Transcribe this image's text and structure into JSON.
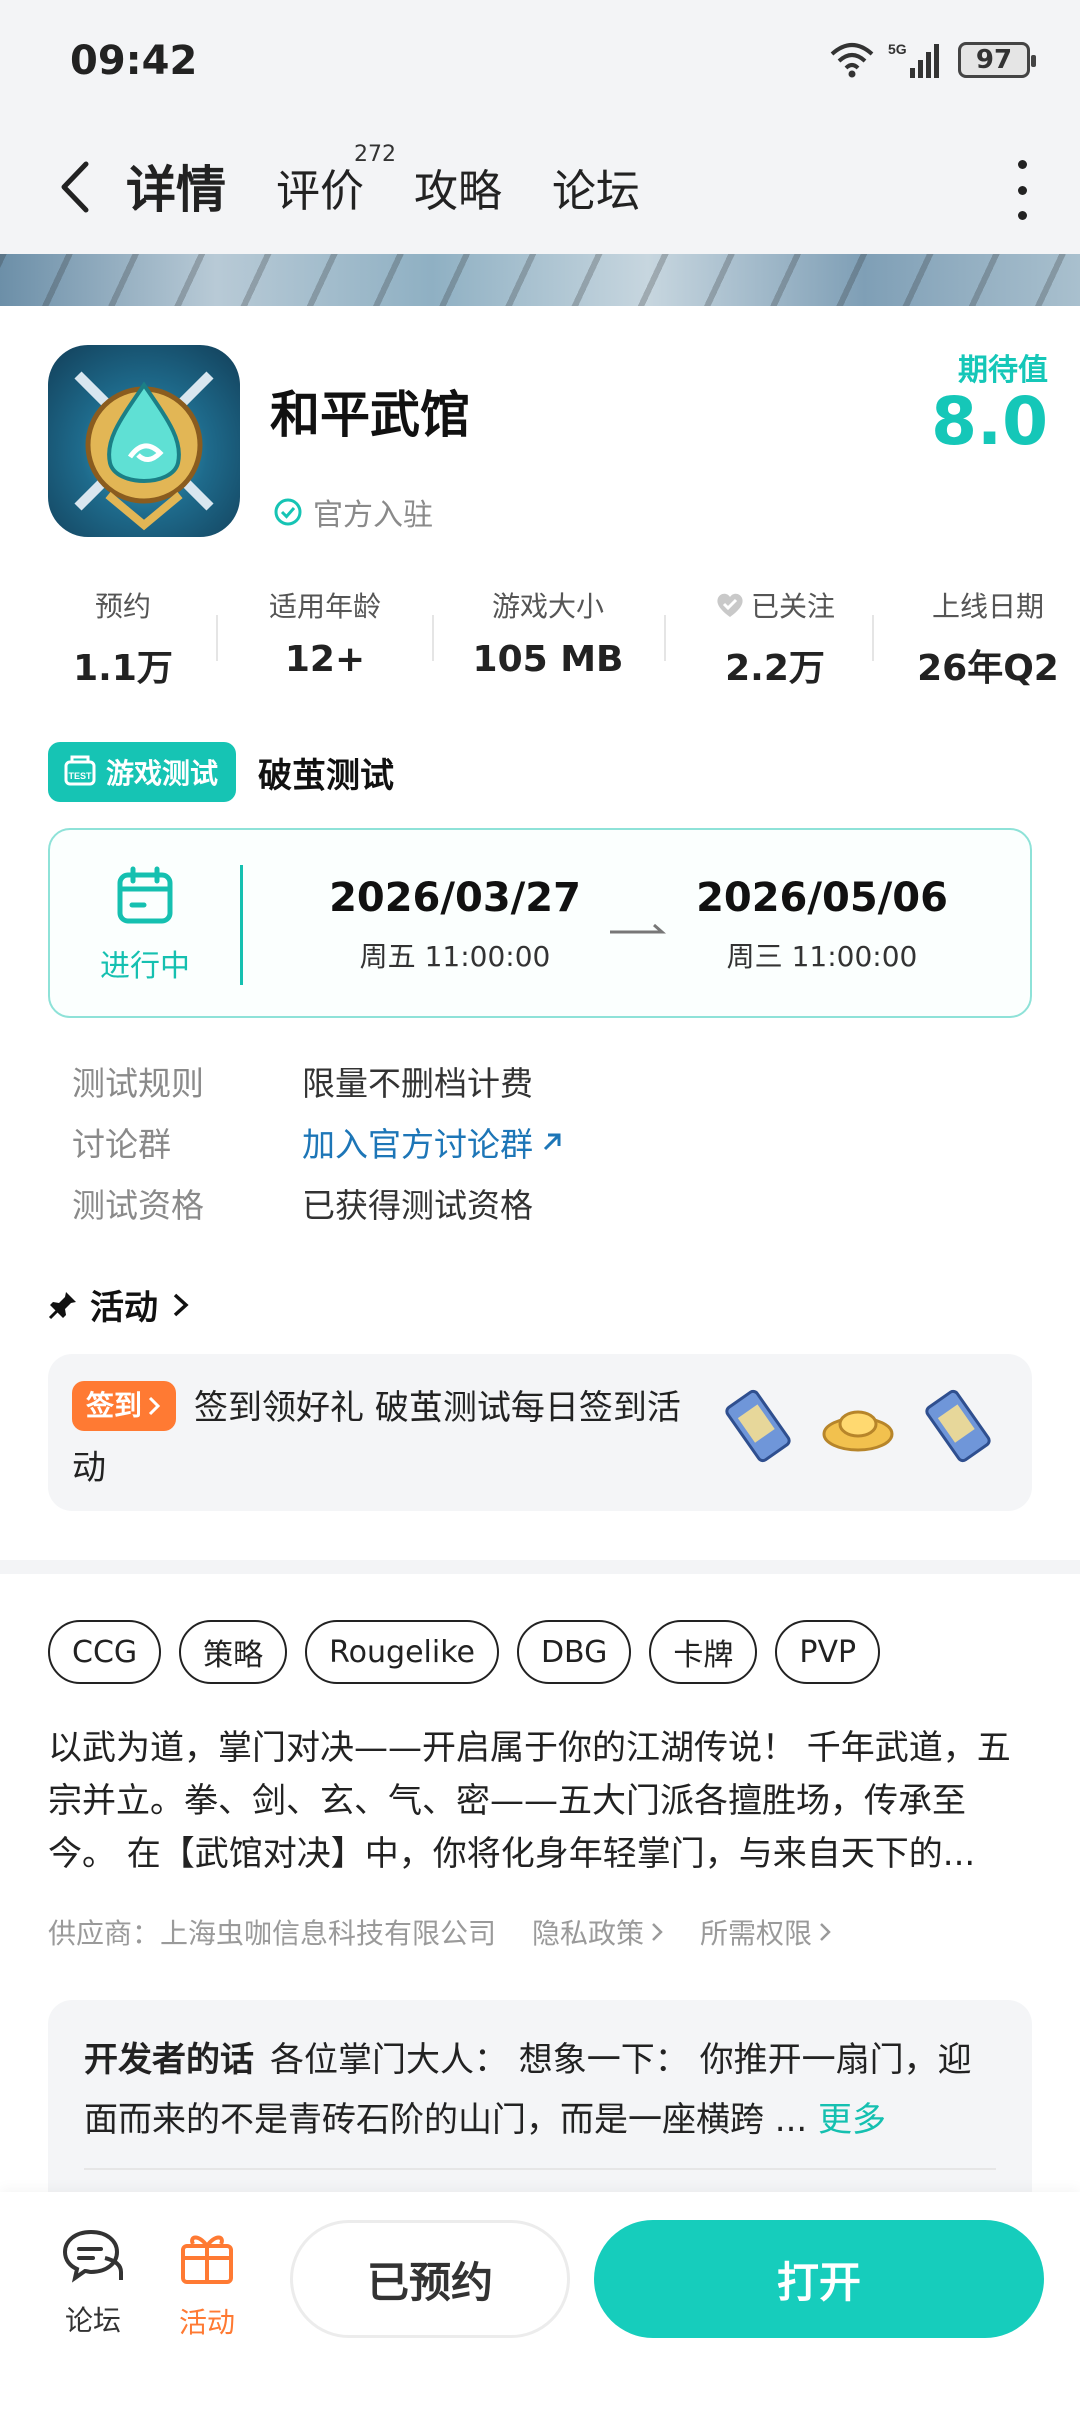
{
  "status_bar": {
    "time": "09:42",
    "network": "5G",
    "battery": "97"
  },
  "nav": {
    "tabs": [
      {
        "label": "详情",
        "active": true
      },
      {
        "label": "评价",
        "badge": "272"
      },
      {
        "label": "攻略"
      },
      {
        "label": "论坛"
      }
    ]
  },
  "app": {
    "title": "和平武馆",
    "official_label": "官方入驻",
    "rating_label": "期待值",
    "rating_value": "8.0"
  },
  "stats": [
    {
      "label": "预约",
      "value": "1.1万"
    },
    {
      "label": "适用年龄",
      "value": "12+"
    },
    {
      "label": "游戏大小",
      "value": "105 MB"
    },
    {
      "label": "已关注",
      "value": "2.2万"
    },
    {
      "label": "上线日期",
      "value": "26年Q2"
    }
  ],
  "test": {
    "badge": "游戏测试",
    "name": "破茧测试",
    "status": "进行中",
    "start_date": "2026/03/27",
    "start_time": "周五  11:00:00",
    "end_date": "2026/05/06",
    "end_time": "周三  11:00:00",
    "rules": [
      {
        "key": "测试规则",
        "value": "限量不删档计费"
      },
      {
        "key": "讨论群",
        "value": "加入官方讨论群"
      },
      {
        "key": "测试资格",
        "value": "已获得测试资格"
      }
    ]
  },
  "activity": {
    "section_title": "活动",
    "badge": "签到",
    "text": "签到领好礼 破茧测试每日签到活动"
  },
  "tags": [
    "CCG",
    "策略",
    "Rougelike",
    "DBG",
    "卡牌",
    "PVP"
  ],
  "description": "以武为道，掌门对决——开启属于你的江湖传说！ 千年武道，五宗并立。拳、剑、玄、气、密——五大门派各擅胜场，传承至今。 在【武馆对决】中，你将化身年轻掌门，与来自天下的...",
  "supplier": {
    "text": "供应商：上海虫咖信息科技有限公司",
    "privacy": "隐私政策",
    "permissions": "所需权限"
  },
  "developer": {
    "label": "开发者的话",
    "text": "各位掌门大人： 想象一下： 你推开一扇门，迎面而来的不是青砖石阶的山门，而是一座横跨 ...",
    "more": "更多"
  },
  "bottom": {
    "forum": "论坛",
    "activity": "活动",
    "reserved": "已预约",
    "open": "打开"
  },
  "colors": {
    "accent": "#16cdbc",
    "link": "#1d76b7",
    "sign_badge": "#ff7a33"
  }
}
